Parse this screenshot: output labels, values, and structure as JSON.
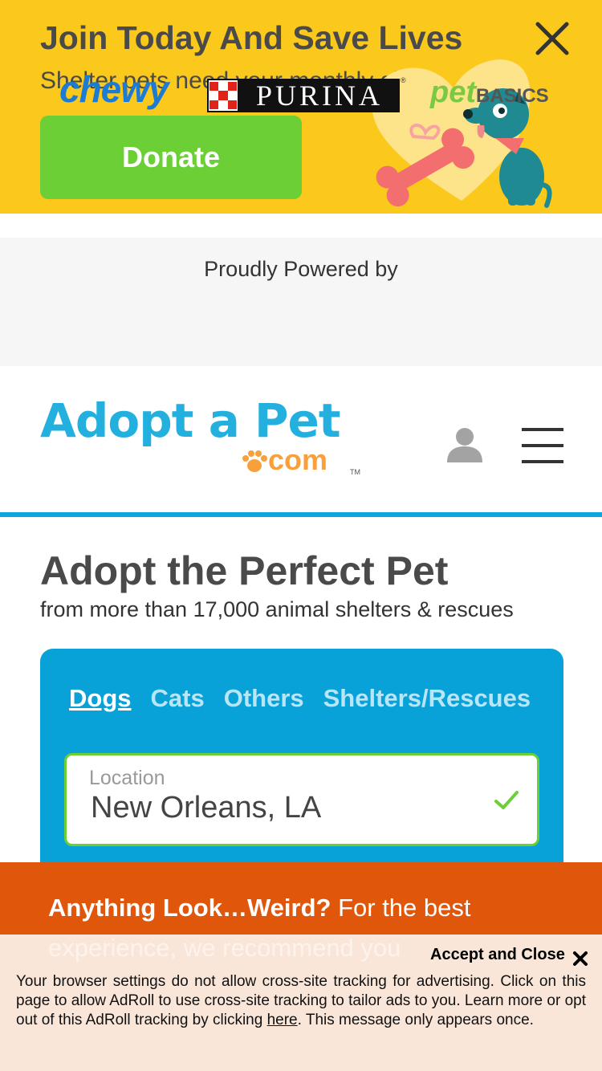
{
  "banner": {
    "title": "Join Today And Save Lives",
    "subtitle": "Shelter pets need your monthly gift",
    "donate_label": "Donate",
    "bg_color": "#fbc81c",
    "button_color": "#6ccf36"
  },
  "powered_by": {
    "label": "Proudly Powered by",
    "sponsors": {
      "chewy": "chewy",
      "purina": "PURINA",
      "purina_reg": "®",
      "petbasics_pet": "pet",
      "petbasics_basics": "BASICS"
    }
  },
  "header": {
    "logo_main": "Adopt a Pet",
    "logo_suffix": "com",
    "logo_tm": "TM",
    "accent_color": "#0ea5d8"
  },
  "hero": {
    "title": "Adopt the Perfect Pet",
    "subtitle": "from more than 17,000 animal shelters & rescues"
  },
  "search": {
    "tabs": [
      {
        "label": "Dogs",
        "active": true
      },
      {
        "label": "Cats",
        "active": false
      },
      {
        "label": "Others",
        "active": false
      },
      {
        "label": "Shelters/Rescues",
        "active": false
      }
    ],
    "location_label": "Location",
    "location_value": "New Orleans, LA"
  },
  "notice": {
    "bold": "Anything Look…Weird?",
    "text": " For the best experience, we recommend you"
  },
  "adroll": {
    "accept_label": "Accept and Close",
    "message_before": "Your browser settings do not allow cross-site tracking for advertising. Click on this page to allow AdRoll to use cross-site tracking to tailor ads to you. Learn more or opt out of this AdRoll tracking by clicking ",
    "link_text": "here",
    "message_after": ". This message only appears once."
  }
}
